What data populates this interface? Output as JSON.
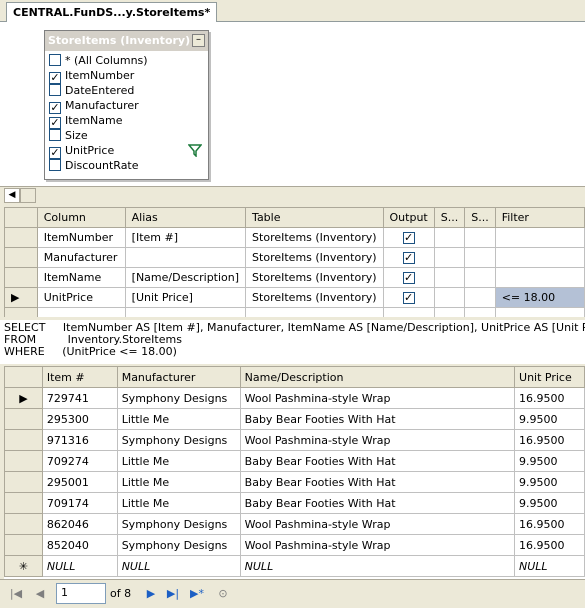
{
  "tab": {
    "title": "CENTRAL.FunDS...y.StoreItems*"
  },
  "diagram": {
    "table_title": "StoreItems (Inventory)",
    "close_label": "–",
    "columns": [
      {
        "label": "* (All Columns)",
        "checked": false
      },
      {
        "label": "ItemNumber",
        "checked": true
      },
      {
        "label": "DateEntered",
        "checked": false
      },
      {
        "label": "Manufacturer",
        "checked": true
      },
      {
        "label": "ItemName",
        "checked": true
      },
      {
        "label": "Size",
        "checked": false
      },
      {
        "label": "UnitPrice",
        "checked": true
      },
      {
        "label": "DiscountRate",
        "checked": false
      }
    ]
  },
  "criteria": {
    "headers": [
      "Column",
      "Alias",
      "Table",
      "Output",
      "S...",
      "S...",
      "Filter"
    ],
    "rows": [
      {
        "column": "ItemNumber",
        "alias": "[Item #]",
        "table": "StoreItems (Inventory)",
        "output": true,
        "filter": ""
      },
      {
        "column": "Manufacturer",
        "alias": "",
        "table": "StoreItems (Inventory)",
        "output": true,
        "filter": ""
      },
      {
        "column": "ItemName",
        "alias": "[Name/Description]",
        "table": "StoreItems (Inventory)",
        "output": true,
        "filter": ""
      },
      {
        "column": "UnitPrice",
        "alias": "[Unit Price]",
        "table": "StoreItems (Inventory)",
        "output": true,
        "filter": "<= 18.00"
      }
    ]
  },
  "sql": {
    "line1_kw": "SELECT",
    "line1": "ItemNumber AS [Item #], Manufacturer, ItemName AS [Name/Description], UnitPrice AS [Unit Price]",
    "line2_kw": "FROM",
    "line2": "Inventory.StoreItems",
    "line3_kw": "WHERE",
    "line3": "(UnitPrice <= 18.00)"
  },
  "results": {
    "headers": [
      "Item #",
      "Manufacturer",
      "Name/Description",
      "Unit Price"
    ],
    "rows": [
      [
        "729741",
        "Symphony Designs",
        "Wool Pashmina-style Wrap",
        "16.9500"
      ],
      [
        "295300",
        "Little Me",
        "Baby Bear Footies With Hat",
        "9.9500"
      ],
      [
        "971316",
        "Symphony Designs",
        "Wool Pashmina-style Wrap",
        "16.9500"
      ],
      [
        "709274",
        "Little Me",
        "Baby Bear Footies With Hat",
        "9.9500"
      ],
      [
        "295001",
        "Little Me",
        "Baby Bear Footies With Hat",
        "9.9500"
      ],
      [
        "709174",
        "Little Me",
        "Baby Bear Footies With Hat",
        "9.9500"
      ],
      [
        "862046",
        "Symphony Designs",
        "Wool Pashmina-style Wrap",
        "16.9500"
      ],
      [
        "852040",
        "Symphony Designs",
        "Wool Pashmina-style Wrap",
        "16.9500"
      ]
    ],
    "null_row": [
      "NULL",
      "NULL",
      "NULL",
      "NULL"
    ]
  },
  "nav": {
    "page_value": "1",
    "of_label": "of 8",
    "first_icon": "first-record-icon",
    "prev_icon": "previous-record-icon",
    "next_icon": "next-record-icon",
    "last_icon": "last-record-icon",
    "new_icon": "new-record-icon",
    "stop_icon": "stop-icon"
  },
  "colors": {
    "highlight": "#b4c1d6",
    "chrome": "#ece9d8",
    "nav_icon_active": "#1c5fc4"
  }
}
